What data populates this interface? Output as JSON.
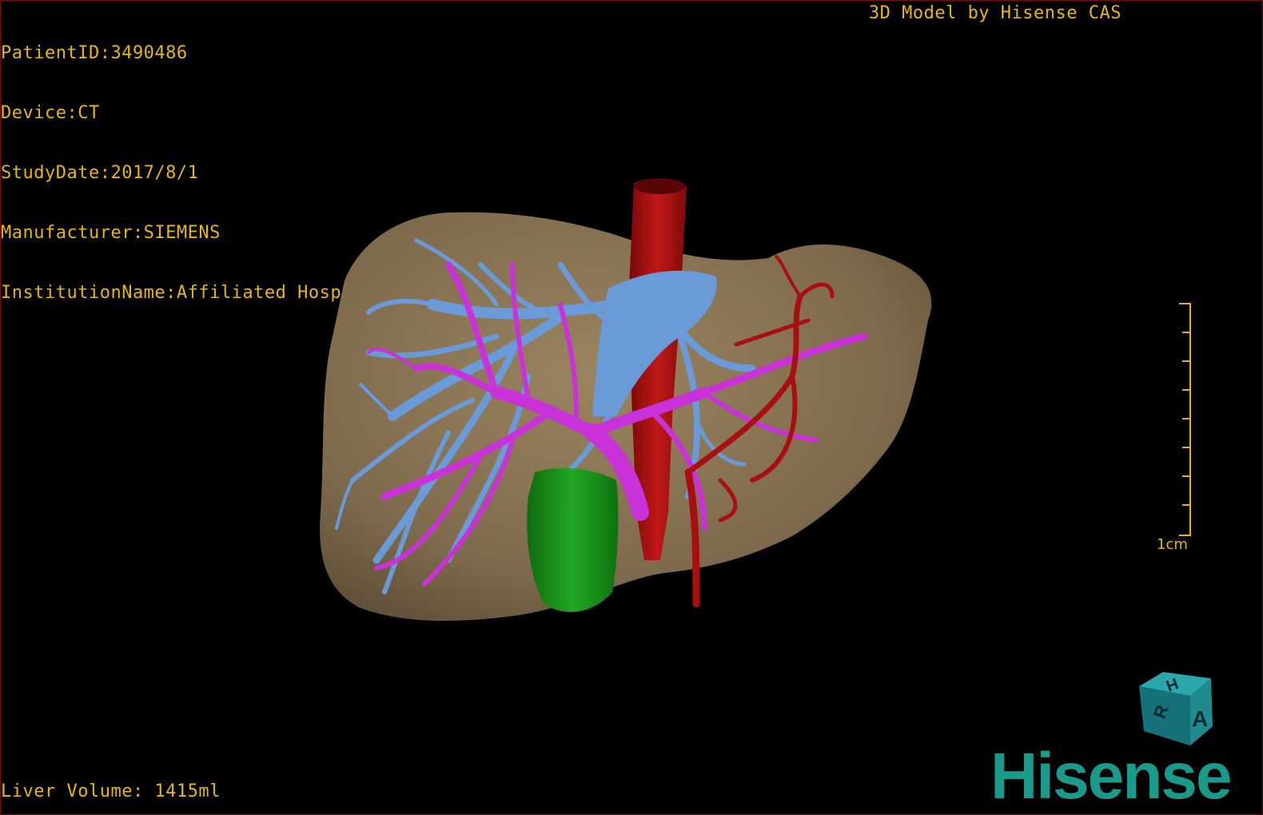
{
  "dicom_info": {
    "patient_id": "PatientID:3490486",
    "device": "Device:CT",
    "study_date": "StudyDate:2017/8/1",
    "manufacturer": "Manufacturer:SIEMENS",
    "institution": "InstitutionName:Affiliated Hospital Qingdao University-C"
  },
  "app_credit": "3D Model by Hisense CAS",
  "liver_volume": "Liver Volume: 1415ml",
  "scale": {
    "label": "1cm"
  },
  "orientation_cube": {
    "top_label": "H",
    "left_label": "R",
    "front_label": "A"
  },
  "brand": {
    "name": "Hisense"
  },
  "model_structures": [
    {
      "name": "liver",
      "color": "#8a7353"
    },
    {
      "name": "portal-vein",
      "color": "#c832d8"
    },
    {
      "name": "hepatic-vein",
      "color": "#6a9ad8"
    },
    {
      "name": "artery-aorta",
      "color": "#a81010"
    },
    {
      "name": "gallbladder",
      "color": "#1a8a1a"
    }
  ],
  "colors": {
    "overlay_text": "#e6b800",
    "brand": "#1a9a8a",
    "cube": "#1f8a90"
  }
}
